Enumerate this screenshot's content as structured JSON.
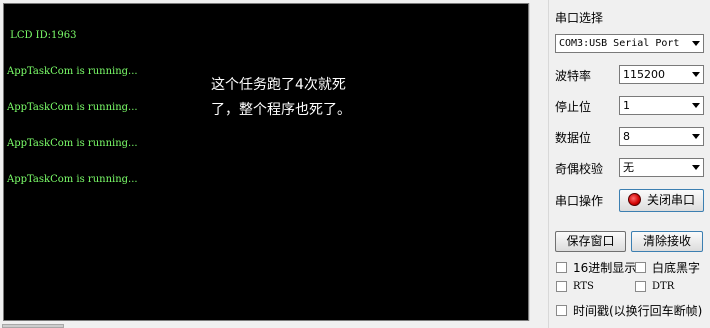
{
  "terminal": {
    "lines": [
      " LCD ID:1963",
      "AppTaskCom is running...",
      "AppTaskCom is running...",
      "AppTaskCom is running...",
      "AppTaskCom is running..."
    ],
    "note": "这个任务跑了4次就死了，整个程序也死了。",
    "text_color": "#7cff6a",
    "background": "#000000"
  },
  "settings": {
    "port_label": "串口选择",
    "port_value": "COM3:USB Serial Port",
    "baud_label": "波特率",
    "baud_value": "115200",
    "stop_label": "停止位",
    "stop_value": "1",
    "data_label": "数据位",
    "data_value": "8",
    "parity_label": "奇偶校验",
    "parity_value": "无",
    "op_label": "串口操作",
    "close_port": "关闭串口"
  },
  "buttons": {
    "save_window": "保存窗口",
    "clear_receive": "清除接收"
  },
  "options": {
    "hex_display": "16进制显示",
    "white_black": "白底黑字",
    "rts": "RTS",
    "dtr": "DTR",
    "timestamp": "时间戳(以换行回车断帧)"
  }
}
